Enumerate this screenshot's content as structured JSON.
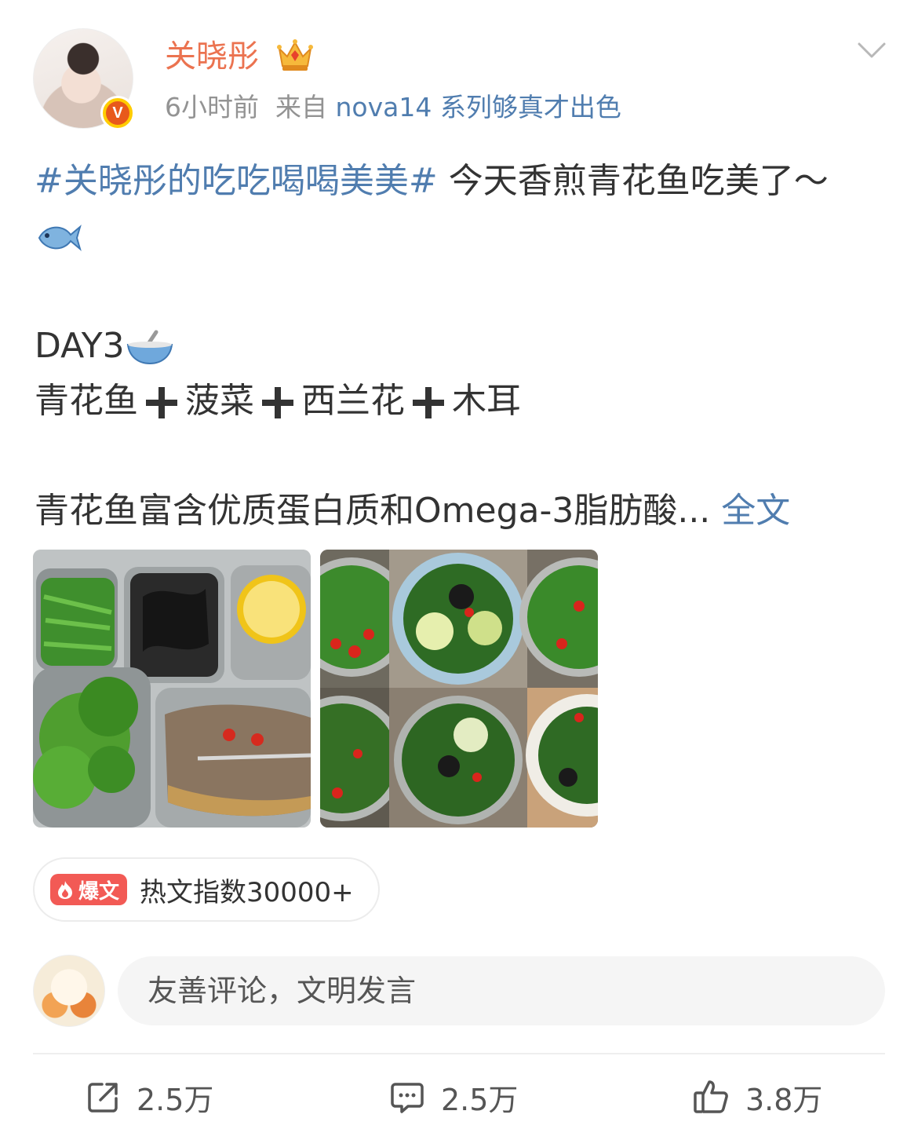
{
  "header": {
    "username": "关晓彤",
    "verified_badge": "V",
    "time": "6小时前",
    "source_prefix": "来自",
    "source": "nova14 系列够真才出色"
  },
  "post": {
    "hashtag": "#关晓彤的吃吃喝喝美美#",
    "text1": " 今天香煎青花鱼吃美了～",
    "day": "DAY3",
    "items": [
      "青花鱼",
      "菠菜",
      "西兰花",
      "木耳"
    ],
    "text2": "青花鱼富含优质蛋白质和Omega-3脂肪酸...",
    "full_link": " 全文"
  },
  "hot_badge": {
    "pill": "爆文",
    "text": "热文指数30000+"
  },
  "comment": {
    "placeholder": "友善评论，文明发言"
  },
  "actions": {
    "repost": "2.5万",
    "comment": "2.5万",
    "like": "3.8万"
  },
  "icons": {
    "crown": "crown-icon",
    "fish": "fish-emoji-icon",
    "bowl": "bowl-emoji-icon",
    "plus": "heavy-plus-icon",
    "chevron": "chevron-down-icon",
    "repost": "share-icon",
    "comment": "comment-icon",
    "like": "thumbs-up-icon"
  },
  "colors": {
    "username": "#eb7350",
    "link": "#507daf",
    "hot": "#f25a55",
    "badge": "#ffcc00"
  }
}
